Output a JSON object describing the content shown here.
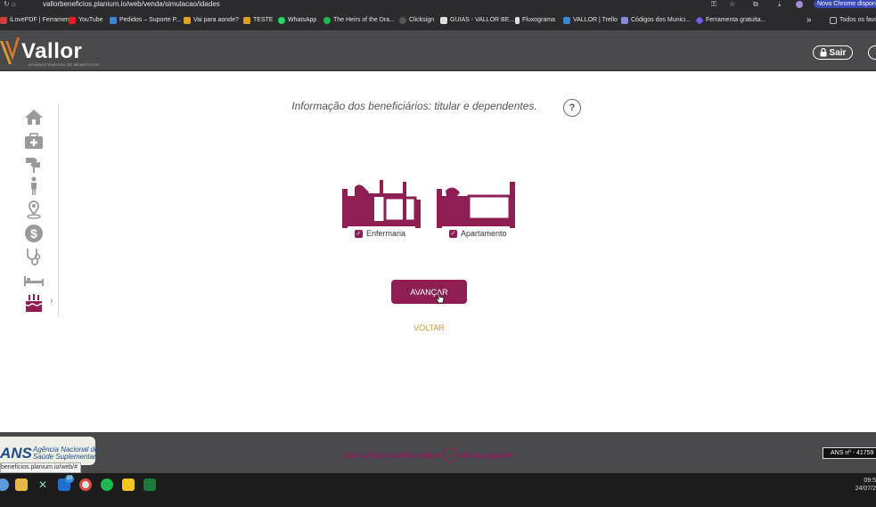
{
  "browser": {
    "url": "vallorbeneficios.planium.io/web/venda/simulacao/idades",
    "promo": "Novo Chrome disponív",
    "bookmarks": [
      {
        "label": "iLovePDF | Ferramen...",
        "color": "#d23b3b"
      },
      {
        "label": "YouTube",
        "color": "#e02020"
      },
      {
        "label": "Pedidos – Suporte P...",
        "color": "#3b86d2"
      },
      {
        "label": "Vai para aonde?",
        "color": "#e0a020"
      },
      {
        "label": "TESTE",
        "color": "#e0a020"
      },
      {
        "label": "WhatsApp",
        "color": "#25d366"
      },
      {
        "label": "The Heirs of the Dra...",
        "color": "#1db954"
      },
      {
        "label": "Clicksign",
        "color": "#555555"
      },
      {
        "label": "GUIAS - VALLOR BE...",
        "color": "#dddddd"
      },
      {
        "label": "Fluxograma",
        "color": "#dddddd"
      },
      {
        "label": "VALLOR | Trello",
        "color": "#3b86d2"
      },
      {
        "label": "Códigos dos Munici...",
        "color": "#8888dd"
      },
      {
        "label": "Ferramenta gratuita...",
        "color": "#7a5cff"
      },
      {
        "label": "Todos os favo",
        "color": "#bbbbbb"
      }
    ],
    "more_glyph": "»"
  },
  "header": {
    "brand": "Vallor",
    "brand_sub": "ADMINISTRADORA DE BENEFÍCIOS",
    "logout_label": "Sair"
  },
  "main": {
    "question": "Informação dos beneficiários: titular e dependentes.",
    "help_glyph": "?",
    "accommodations": [
      {
        "label": "Enfermaria",
        "checked": true
      },
      {
        "label": "Apartamento",
        "checked": true
      }
    ],
    "next_label": "AVANÇAR",
    "back_label": "VOLTAR"
  },
  "sidebar": {
    "items": [
      "home-icon",
      "medical-kit-icon",
      "signpost-icon",
      "person-icon",
      "location-icon",
      "dollar-icon",
      "stethoscope-icon",
      "bed-icon",
      "birthday-cake-icon"
    ],
    "active": "birthday-cake-icon",
    "expand_glyph": "›"
  },
  "footer": {
    "ans_logo": "ANS",
    "ans_name_1": "Agência Nacional de",
    "ans_name_2": "Saúde Suplementar",
    "warning_prefix": "Não utilize o botão voltar",
    "warning_suffix": "do navegador",
    "ans_registration": "ANS nº - 41759",
    "status_url": "beneficios.planium.io/web/#"
  },
  "taskbar": {
    "time": "09:5",
    "date": "24/07/2",
    "mail_badge": "10"
  },
  "colors": {
    "brand": "#8f1e55",
    "accent": "#d6932d",
    "chrome_bg": "#4a4a4d"
  }
}
